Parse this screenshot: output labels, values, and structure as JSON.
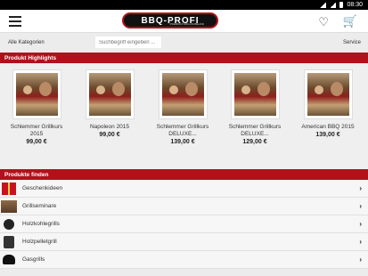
{
  "status_bar": {
    "time": "08:30"
  },
  "app_bar": {
    "logo_text": "BBQ-PROFI",
    "logo_subtext": "PREMIUM GRILLZUBEHÖR"
  },
  "search_row": {
    "category_label": "Alle Kategorien",
    "search_placeholder": "Suchbegriff eingeben ...",
    "service_label": "Service"
  },
  "highlights": {
    "title": "Produkt Highlights",
    "products": [
      {
        "name": "Schlemmer Grillkurs 2015",
        "price": "99,00 €"
      },
      {
        "name": "Napoleon 2015",
        "price": "99,00 €"
      },
      {
        "name": "Schlemmer Grillkurs DELUXE...",
        "price": "139,00 €"
      },
      {
        "name": "Schlemmer Grillkurs DELUXE...",
        "price": "129,00 €"
      },
      {
        "name": "American BBQ 2015",
        "price": "139,00 €"
      }
    ]
  },
  "find": {
    "title": "Produkte finden",
    "items": [
      {
        "label": "Geschenkideen",
        "icon": "gift-icon"
      },
      {
        "label": "Grillseminare",
        "icon": "seminar-icon"
      },
      {
        "label": "Holzkohlegrills",
        "icon": "charcoal-grill-icon"
      },
      {
        "label": "Holzpelletgrill",
        "icon": "pellet-grill-icon"
      },
      {
        "label": "Gasgrills",
        "icon": "gas-grill-icon"
      }
    ]
  }
}
